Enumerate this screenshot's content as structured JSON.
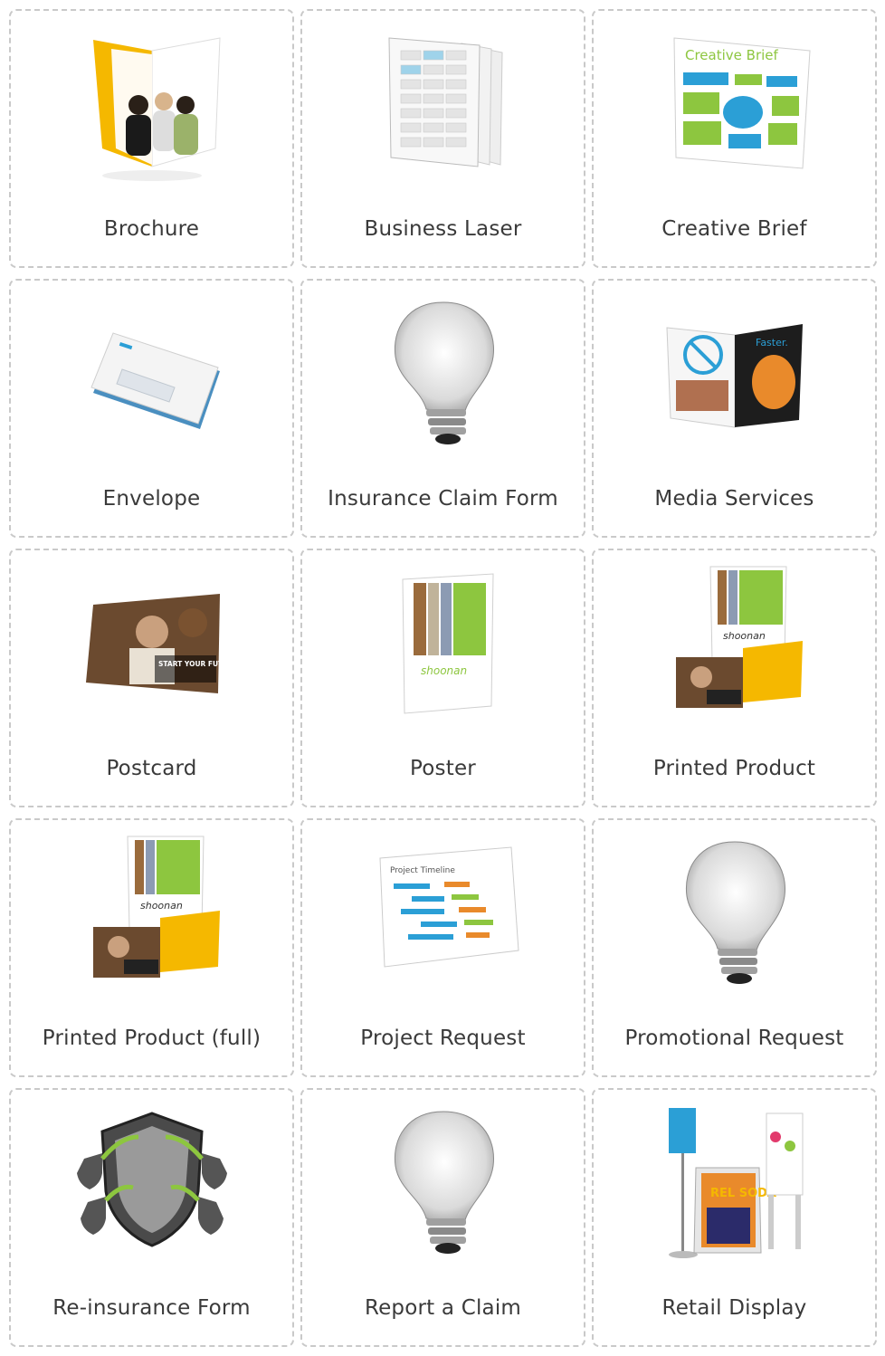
{
  "tiles": [
    {
      "label": "Brochure",
      "icon": "brochure-icon"
    },
    {
      "label": "Business Laser",
      "icon": "business-laser-icon"
    },
    {
      "label": "Creative Brief",
      "icon": "creative-brief-icon"
    },
    {
      "label": "Envelope",
      "icon": "envelope-icon"
    },
    {
      "label": "Insurance Claim Form",
      "icon": "lightbulb-icon"
    },
    {
      "label": "Media Services",
      "icon": "magazine-icon"
    },
    {
      "label": "Postcard",
      "icon": "postcard-icon"
    },
    {
      "label": "Poster",
      "icon": "poster-icon"
    },
    {
      "label": "Printed Product",
      "icon": "printed-product-icon"
    },
    {
      "label": "Printed Product (full)",
      "icon": "printed-product-icon"
    },
    {
      "label": "Project Request",
      "icon": "project-timeline-icon"
    },
    {
      "label": "Promotional Request",
      "icon": "lightbulb-icon"
    },
    {
      "label": "Re-insurance Form",
      "icon": "shield-icon"
    },
    {
      "label": "Report a Claim",
      "icon": "lightbulb-icon"
    },
    {
      "label": "Retail Display",
      "icon": "retail-display-icon"
    }
  ],
  "colors": {
    "border": "#c9c9c9",
    "label": "#3a3a3a",
    "accent_green": "#8dc63f",
    "accent_blue": "#2b9fd6",
    "accent_orange": "#e98a2b",
    "accent_yellow": "#f5b800"
  },
  "artwork_text": {
    "creative_brief_title": "Creative Brief",
    "media_headline": "Faster.",
    "postcard_headline": "START YOUR FUTURE TODAY",
    "brand": "shoonan",
    "timeline_title": "Project Timeline",
    "retail_brand": "REL SODA"
  }
}
